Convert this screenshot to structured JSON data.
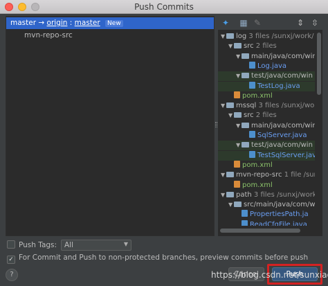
{
  "window": {
    "title": "Push Commits"
  },
  "commits": {
    "branch_local": "master",
    "arrow": "→",
    "remote": "origin",
    "separator": ":",
    "branch_remote": "master",
    "badge": "New",
    "module": "mvn-repo-src"
  },
  "toolbar": {
    "icons": [
      "pin-icon",
      "expand-icon",
      "edit-icon",
      "expand-all-icon",
      "collapse-all-icon"
    ]
  },
  "tree": [
    {
      "indent": 0,
      "arrow": "▼",
      "kind": "folder",
      "name": "log",
      "meta": "3 files  /sunxj/work/"
    },
    {
      "indent": 1,
      "arrow": "▼",
      "kind": "folder",
      "name": "src",
      "meta": "2 files"
    },
    {
      "indent": 2,
      "arrow": "▼",
      "kind": "folder",
      "name": "main/java/com/wir",
      "meta": ""
    },
    {
      "indent": 3,
      "arrow": "",
      "kind": "java",
      "name": "Log.java",
      "meta": ""
    },
    {
      "indent": 2,
      "arrow": "▼",
      "kind": "folder",
      "name": "test/java/com/win",
      "meta": "",
      "green": true
    },
    {
      "indent": 3,
      "arrow": "",
      "kind": "java",
      "name": "TestLog.java",
      "meta": "",
      "green": true
    },
    {
      "indent": 1,
      "arrow": "",
      "kind": "xml",
      "name": "pom.xml",
      "meta": ""
    },
    {
      "indent": 0,
      "arrow": "▼",
      "kind": "folder",
      "name": "mssql",
      "meta": "3 files  /sunxj/wor"
    },
    {
      "indent": 1,
      "arrow": "▼",
      "kind": "folder",
      "name": "src",
      "meta": "2 files"
    },
    {
      "indent": 2,
      "arrow": "▼",
      "kind": "folder",
      "name": "main/java/com/wir",
      "meta": ""
    },
    {
      "indent": 3,
      "arrow": "",
      "kind": "java",
      "name": "SqlServer.java",
      "meta": ""
    },
    {
      "indent": 2,
      "arrow": "▼",
      "kind": "folder",
      "name": "test/java/com/win",
      "meta": "",
      "green": true
    },
    {
      "indent": 3,
      "arrow": "",
      "kind": "java",
      "name": "TestSqlServer.java",
      "meta": "",
      "green": true
    },
    {
      "indent": 1,
      "arrow": "",
      "kind": "xml",
      "name": "pom.xml",
      "meta": ""
    },
    {
      "indent": 0,
      "arrow": "▼",
      "kind": "folder",
      "name": "mvn-repo-src",
      "meta": "1 file  /sunxj/w"
    },
    {
      "indent": 1,
      "arrow": "",
      "kind": "xml",
      "name": "pom.xml",
      "meta": ""
    },
    {
      "indent": 0,
      "arrow": "▼",
      "kind": "folder",
      "name": "path",
      "meta": "3 files  /sunxj/work"
    },
    {
      "indent": 1,
      "arrow": "▼",
      "kind": "folder",
      "name": "src/main/java/com/wi",
      "meta": ""
    },
    {
      "indent": 2,
      "arrow": "",
      "kind": "java",
      "name": "PropertiesPath.ja",
      "meta": ""
    },
    {
      "indent": 2,
      "arrow": "",
      "kind": "java",
      "name": "ReadCfgFile.java",
      "meta": ""
    }
  ],
  "options": {
    "push_tags_label": "Push Tags:",
    "push_tags_checked": false,
    "push_tags_value": "All",
    "preview_label": "For Commit and Push to non-protected branches, preview commits before push",
    "preview_checked": true
  },
  "buttons": {
    "help": "?",
    "cancel": "Cancel",
    "push": "Push"
  },
  "watermark": "https://blog.csdn.net/sunxiaoju",
  "colors": {
    "selection": "#2f65ca",
    "push_button": "#365880",
    "highlight": "#d42222"
  }
}
